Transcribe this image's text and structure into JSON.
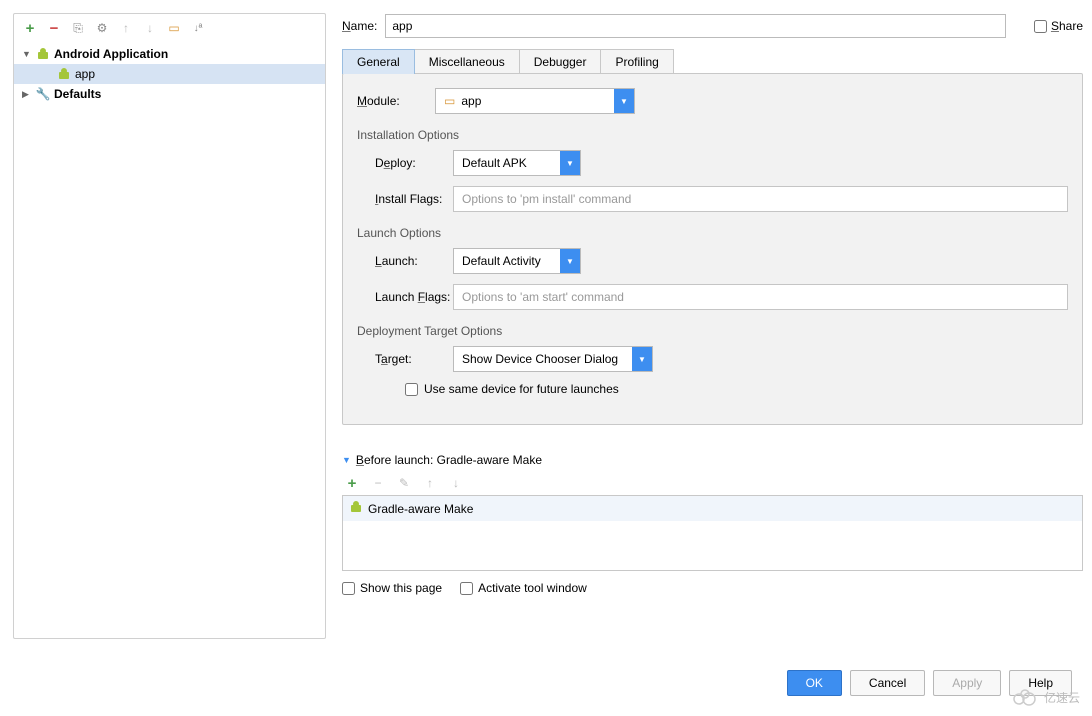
{
  "name_label": "Name:",
  "name_value": "app",
  "share_label": "Share",
  "sidebar": {
    "android_app": "Android Application",
    "app": "app",
    "defaults": "Defaults"
  },
  "tabs": {
    "general": "General",
    "misc": "Miscellaneous",
    "debugger": "Debugger",
    "profiling": "Profiling"
  },
  "module": {
    "label": "Module:",
    "value": "app"
  },
  "install": {
    "title": "Installation Options",
    "deploy_label": "Deploy:",
    "deploy_value": "Default APK",
    "flags_label": "Install Flags:",
    "flags_placeholder": "Options to 'pm install' command"
  },
  "launch": {
    "title": "Launch Options",
    "launch_label": "Launch:",
    "launch_value": "Default Activity",
    "flags_label": "Launch Flags:",
    "flags_placeholder": "Options to 'am start' command"
  },
  "target": {
    "title": "Deployment Target Options",
    "target_label": "Target:",
    "target_value": "Show Device Chooser Dialog",
    "same_device": "Use same device for future launches"
  },
  "before": {
    "title": "Before launch: Gradle-aware Make",
    "item": "Gradle-aware Make"
  },
  "show_page": "Show this page",
  "activate_tw": "Activate tool window",
  "buttons": {
    "ok": "OK",
    "cancel": "Cancel",
    "apply": "Apply",
    "help": "Help"
  },
  "watermark": "亿速云"
}
